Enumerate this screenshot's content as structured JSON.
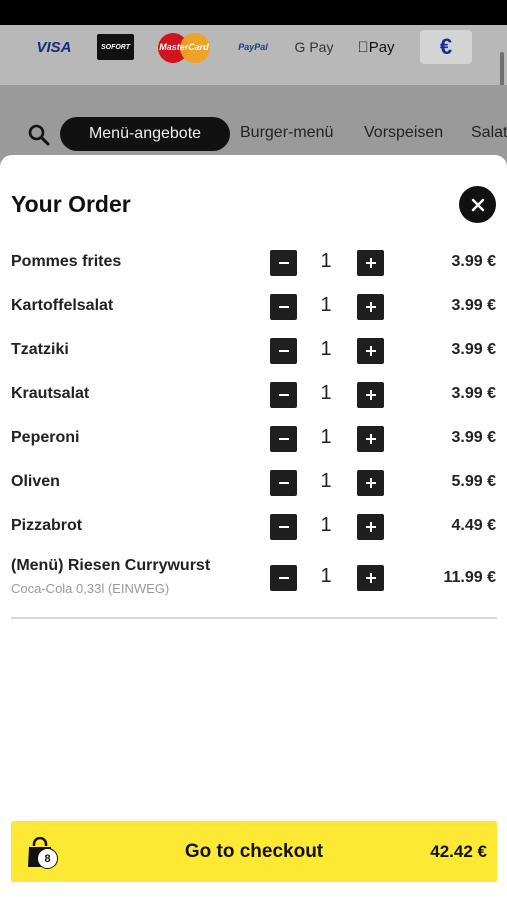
{
  "payment_methods": {
    "visa": "VISA",
    "sofort": "SOFORT",
    "mastercard": "MasterCard",
    "paypal": "PayPal",
    "gpay": "G Pay",
    "applepay": "Pay",
    "currency": "€"
  },
  "nav": {
    "active_tab": "Menü-angebote",
    "tabs": [
      "Burger-menü",
      "Vorspeisen",
      "Salat"
    ]
  },
  "order": {
    "title": "Your Order",
    "items": [
      {
        "name": "Pommes frites",
        "sub": "",
        "qty": "1",
        "price": "3.99 €"
      },
      {
        "name": "Kartoffelsalat",
        "sub": "",
        "qty": "1",
        "price": "3.99 €"
      },
      {
        "name": "Tzatziki",
        "sub": "",
        "qty": "1",
        "price": "3.99 €"
      },
      {
        "name": "Krautsalat",
        "sub": "",
        "qty": "1",
        "price": "3.99 €"
      },
      {
        "name": "Peperoni",
        "sub": "",
        "qty": "1",
        "price": "3.99 €"
      },
      {
        "name": "Oliven",
        "sub": "",
        "qty": "1",
        "price": "5.99 €"
      },
      {
        "name": "Pizzabrot",
        "sub": "",
        "qty": "1",
        "price": "4.49 €"
      },
      {
        "name": "(Menü) Riesen Currywurst",
        "sub": "Coca-Cola 0,33l (EINWEG)",
        "qty": "1",
        "price": "11.99 €"
      }
    ]
  },
  "checkout": {
    "label": "Go to checkout",
    "total": "42.42 €",
    "item_count": "8"
  },
  "colors": {
    "accent": "#fde933",
    "dark": "#111111"
  }
}
